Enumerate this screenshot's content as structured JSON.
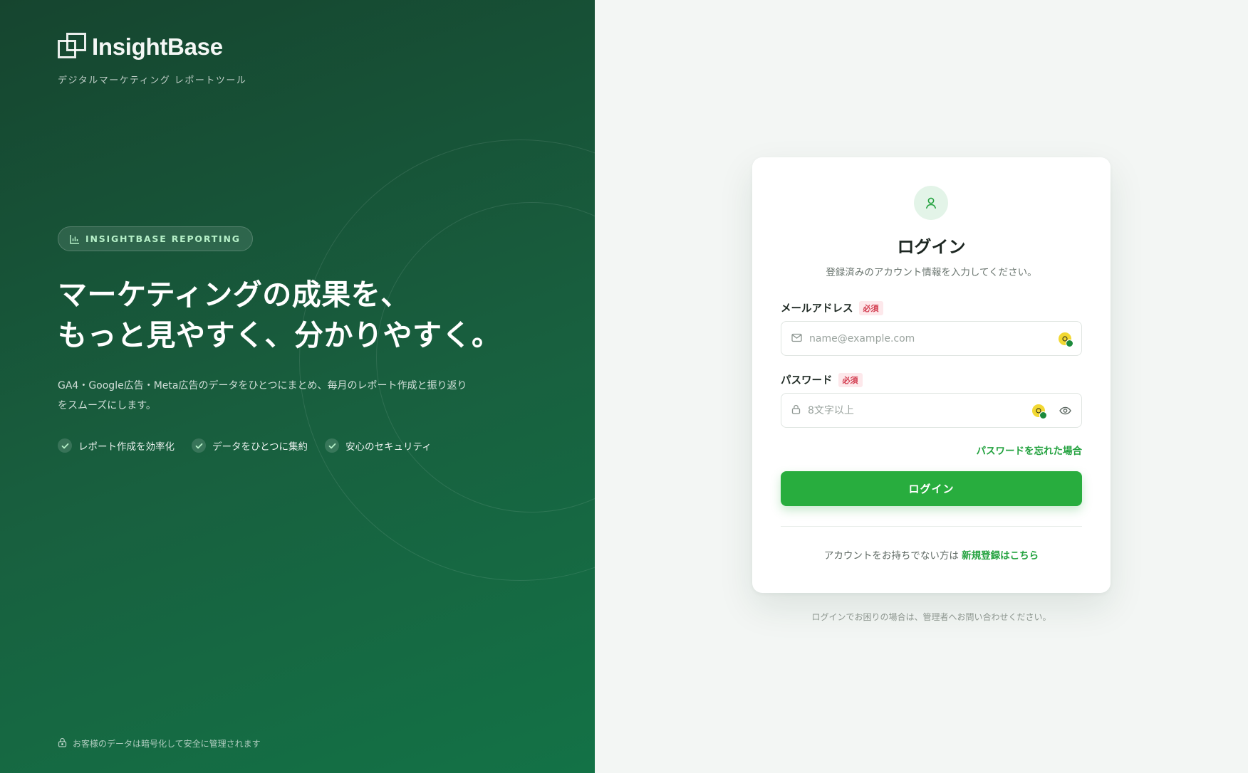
{
  "brand": {
    "name": "InsightBase",
    "tagline": "デジタルマーケティング レポートツール"
  },
  "hero": {
    "badge": "INSIGHTBASE REPORTING",
    "headline_line1": "マーケティングの成果を、",
    "headline_line2": "もっと見やすく、分かりやすく。",
    "description": "GA4・Google広告・Meta広告のデータをひとつにまとめ、毎月のレポート作成と振り返りをスムーズにします。",
    "features": [
      {
        "label": "レポート作成を効率化",
        "icon": "check-icon"
      },
      {
        "label": "データをひとつに集約",
        "icon": "check-icon"
      },
      {
        "label": "安心のセキュリティ",
        "icon": "check-icon"
      }
    ],
    "security_note": "お客様のデータは暗号化して安全に管理されます"
  },
  "login": {
    "title": "ログイン",
    "subtitle": "登録済みのアカウント情報を入力してください。",
    "email": {
      "label": "メールアドレス",
      "required": "必須",
      "placeholder": "name@example.com",
      "value": ""
    },
    "password": {
      "label": "パスワード",
      "required": "必須",
      "placeholder": "8文字以上",
      "value": ""
    },
    "forgot_link": "パスワードを忘れた場合",
    "submit_label": "ログイン",
    "signup_prompt": "アカウントをお持ちでない方は",
    "signup_link": "新規登録はこちら"
  },
  "help_text": "ログインでお困りの場合は、管理者へお問い合わせください。",
  "colors": {
    "panel_dark": "#16452f",
    "panel_light": "#137246",
    "accent": "#28ad3e",
    "required": "#d23b4e"
  }
}
